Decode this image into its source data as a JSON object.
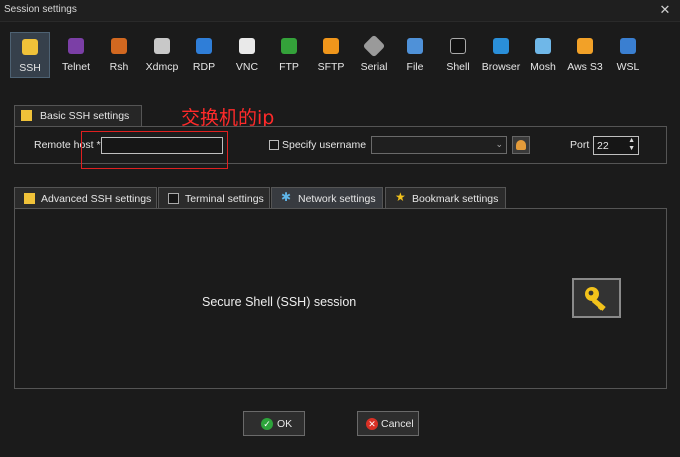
{
  "window": {
    "title": "Session settings",
    "close_glyph": "✕"
  },
  "protocols": [
    {
      "label": "SSH",
      "icon": "key-icon",
      "selected": true
    },
    {
      "label": "Telnet",
      "icon": "telnet-icon"
    },
    {
      "label": "Rsh",
      "icon": "rsh-icon"
    },
    {
      "label": "Xdmcp",
      "icon": "x-display-icon"
    },
    {
      "label": "RDP",
      "icon": "rdp-monitor-icon"
    },
    {
      "label": "VNC",
      "icon": "vnc-icon"
    },
    {
      "label": "FTP",
      "icon": "ftp-globe-icon"
    },
    {
      "label": "SFTP",
      "icon": "sftp-icon"
    },
    {
      "label": "Serial",
      "icon": "serial-plug-icon"
    },
    {
      "label": "File",
      "icon": "file-monitor-icon"
    },
    {
      "label": "Shell",
      "icon": "terminal-icon"
    },
    {
      "label": "Browser",
      "icon": "globe-icon"
    },
    {
      "label": "Mosh",
      "icon": "satellite-icon"
    },
    {
      "label": "Aws S3",
      "icon": "aws-cubes-icon"
    },
    {
      "label": "WSL",
      "icon": "windows-icon"
    }
  ],
  "basic": {
    "tab_label": "Basic SSH settings",
    "remote_host_label": "Remote host *",
    "remote_host_value": "",
    "specify_username_label": "Specify username",
    "specify_username_checked": false,
    "username_value": "",
    "port_label": "Port",
    "port_value": "22"
  },
  "annotation": "交换机的ip",
  "tabs": [
    {
      "label": "Advanced SSH settings",
      "icon": "key-icon"
    },
    {
      "label": "Terminal settings",
      "icon": "terminal-icon"
    },
    {
      "label": "Network settings",
      "icon": "network-star-icon",
      "active": true
    },
    {
      "label": "Bookmark settings",
      "icon": "star-icon"
    }
  ],
  "panel": {
    "session_text": "Secure Shell (SSH) session"
  },
  "buttons": {
    "ok": "OK",
    "cancel": "Cancel"
  },
  "colors": {
    "annotation": "#ff2a2a",
    "ok_icon": "#2da43b",
    "cancel_icon": "#d93025",
    "key_icon": "#f2c21b"
  }
}
